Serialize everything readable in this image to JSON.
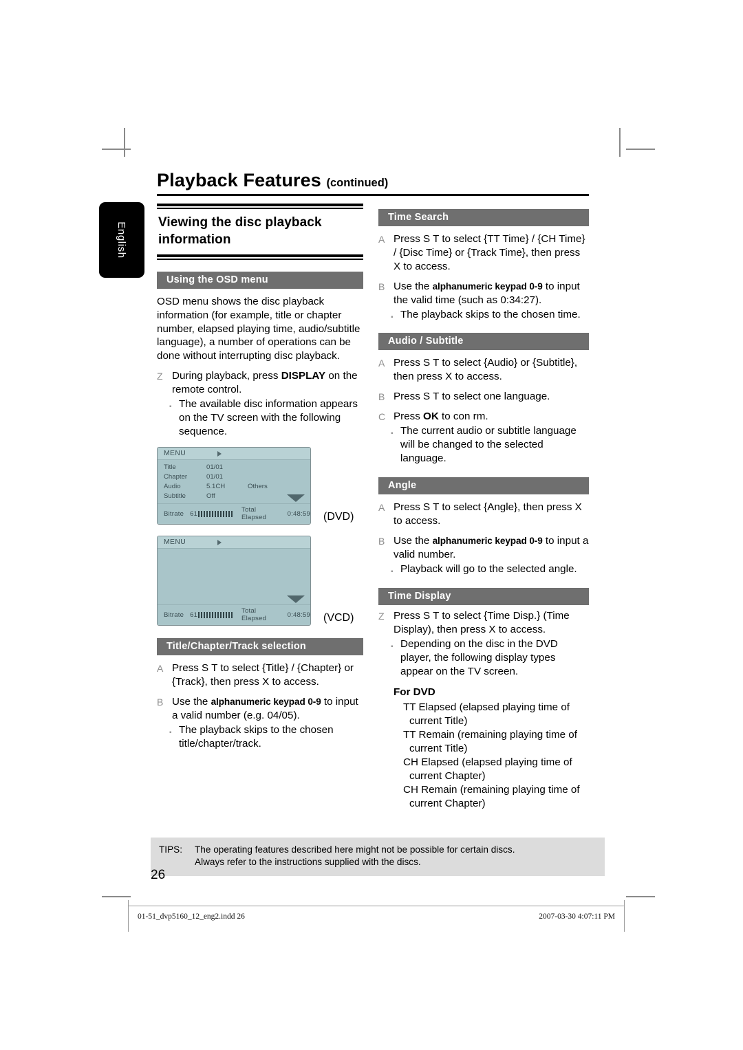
{
  "document": {
    "chapter_title": "Playback Features",
    "chapter_title_suffix": "(continued)",
    "language_tab": "English",
    "page_number": "26"
  },
  "left_column": {
    "main_heading": "Viewing the disc playback information",
    "osd_section": {
      "bar_label": "Using the OSD menu",
      "intro": "OSD menu shows the disc playback information (for example, title or chapter number, elapsed playing time, audio/subtitle language), a number of operations can be done without interrupting disc playback.",
      "step1_marker": "Z",
      "step1_pre": "During playback, press ",
      "step1_key": "DISPLAY",
      "step1_post": " on the remote control.",
      "step1_sub": "The available disc information appears on the TV screen with the following sequence."
    },
    "osd_dvd": {
      "caption": "(DVD)",
      "menu_label": "MENU",
      "rows": [
        {
          "key": "Title",
          "value": "01/01",
          "value2": ""
        },
        {
          "key": "Chapter",
          "value": "01/01",
          "value2": ""
        },
        {
          "key": "Audio",
          "value": "5.1CH",
          "value2": "Others"
        },
        {
          "key": "Subtitle",
          "value": "Off",
          "value2": ""
        }
      ],
      "footer_bitrate_label": "Bitrate",
      "footer_bitrate_value": "61",
      "footer_elapsed_label": "Total Elapsed",
      "footer_elapsed_value": "0:48:59"
    },
    "osd_vcd": {
      "caption": "(VCD)",
      "menu_label": "MENU",
      "footer_bitrate_label": "Bitrate",
      "footer_bitrate_value": "61",
      "footer_elapsed_label": "Total Elapsed",
      "footer_elapsed_value": "0:48:59"
    },
    "title_chapter_section": {
      "bar_label": "Title/Chapter/Track selection",
      "stepA_marker": "A",
      "stepA_text": "Press S T to select {Title} / {Chapter} or {Track}, then press X to access.",
      "stepB_marker": "B",
      "stepB_pre": "Use the ",
      "stepB_key": "alphanumeric keypad 0-9",
      "stepB_post": " to input a valid number (e.g. 04/05).",
      "stepB_sub": "The playback skips to the chosen title/chapter/track."
    }
  },
  "right_column": {
    "time_search": {
      "bar_label": "Time Search",
      "stepA_marker": "A",
      "stepA_text": "Press S T to select {TT Time} / {CH Time} / {Disc Time} or {Track Time}, then press X to access.",
      "stepB_marker": "B",
      "stepB_pre": "Use the ",
      "stepB_key": "alphanumeric keypad 0-9",
      "stepB_post": " to input the valid time (such as 0:34:27).",
      "stepB_sub": "The playback skips to the chosen time."
    },
    "audio_subtitle": {
      "bar_label": "Audio / Subtitle",
      "stepA_marker": "A",
      "stepA_text": "Press S T to select {Audio} or {Subtitle}, then press X to access.",
      "stepB_marker": "B",
      "stepB_text": "Press S T to select one language.",
      "stepC_marker": "C",
      "stepC_pre": "Press ",
      "stepC_key": "OK",
      "stepC_post": " to con rm.",
      "stepC_sub": "The current audio or subtitle language will be changed to the selected language."
    },
    "angle": {
      "bar_label": "Angle",
      "stepA_marker": "A",
      "stepA_text": "Press S T to select {Angle}, then press X to access.",
      "stepB_marker": "B",
      "stepB_pre": "Use the ",
      "stepB_key": "alphanumeric keypad 0-9",
      "stepB_post": " to input a valid number.",
      "stepB_sub": "Playback will go to the selected angle."
    },
    "time_display": {
      "bar_label": "Time Display",
      "step_marker": "Z",
      "step_text": "Press S T to select {Time Disp.} (Time Display), then press X to access.",
      "step_sub": "Depending on the disc in the DVD player, the following display types appear on the TV screen.",
      "for_dvd_label": "For DVD",
      "for_dvd_items": [
        "TT Elapsed (elapsed playing time of current Title)",
        "TT Remain (remaining playing time of current Title)",
        "CH Elapsed (elapsed playing time of current Chapter)",
        "CH Remain (remaining playing time of current Chapter)"
      ]
    }
  },
  "tips": {
    "label": "TIPS:",
    "line1": "The operating features described here might not be possible for certain discs.",
    "line2": "Always refer to the instructions supplied with the discs."
  },
  "print_footer": {
    "filename": "01-51_dvp5160_12_eng2.indd   26",
    "timestamp": "2007-03-30   4:07:11 PM"
  },
  "colors": {
    "bar_gray": "#6f6f6f",
    "tips_gray": "#dcdcdc",
    "osd_body": "#a9c5c9",
    "osd_header": "#b9d2d5",
    "tab_black": "#000000"
  }
}
